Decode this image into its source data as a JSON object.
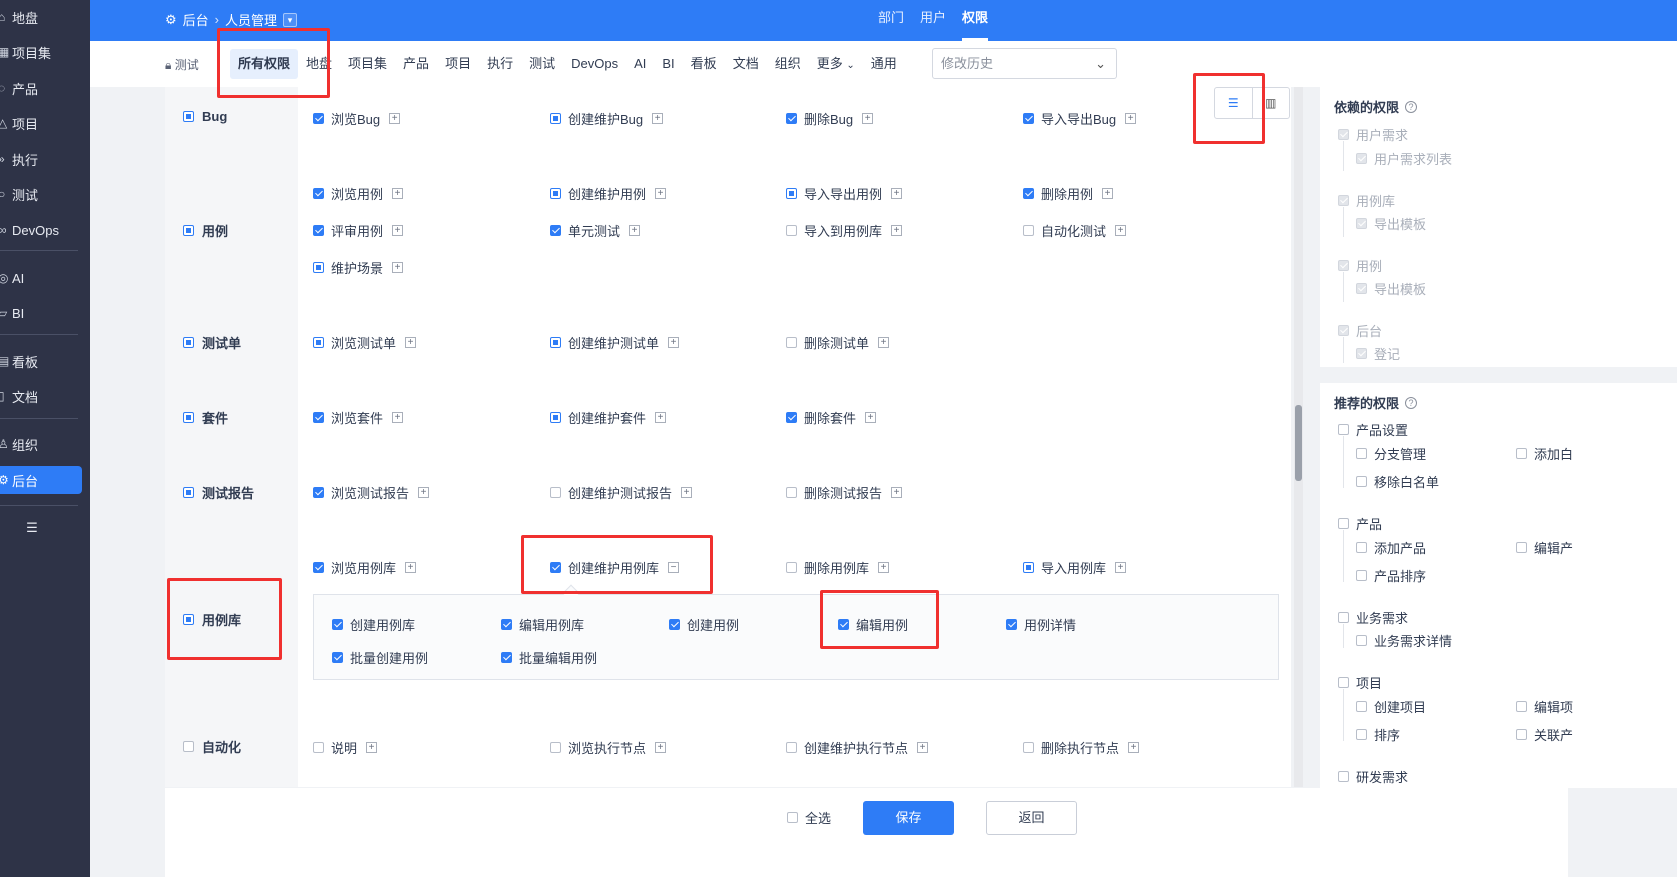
{
  "sidebar": {
    "items": [
      {
        "label": "地盘",
        "icon": "home-icon"
      },
      {
        "label": "项目集",
        "icon": "program-icon"
      },
      {
        "label": "产品",
        "icon": "product-icon"
      },
      {
        "label": "项目",
        "icon": "project-icon"
      },
      {
        "label": "执行",
        "icon": "execution-icon"
      },
      {
        "label": "测试",
        "icon": "test-icon"
      },
      {
        "label": "DevOps",
        "icon": "devops-icon"
      },
      {
        "label": "AI",
        "icon": "ai-icon"
      },
      {
        "label": "BI",
        "icon": "bi-icon"
      },
      {
        "label": "看板",
        "icon": "kanban-icon"
      },
      {
        "label": "文档",
        "icon": "doc-icon"
      },
      {
        "label": "组织",
        "icon": "org-icon"
      },
      {
        "label": "后台",
        "icon": "admin-gear-icon"
      }
    ],
    "active": "后台",
    "collapse_icon": "indent-icon"
  },
  "topbar": {
    "breadcrumb": [
      "后台",
      "人员管理"
    ],
    "nav": [
      "部门",
      "用户",
      "权限"
    ],
    "active_nav": "权限"
  },
  "subbar": {
    "group_label": "测试",
    "tabs": [
      "所有权限",
      "地盘",
      "项目集",
      "产品",
      "项目",
      "执行",
      "测试",
      "DevOps",
      "AI",
      "BI",
      "看板",
      "文档",
      "组织",
      "更多",
      "通用"
    ],
    "active_tab": "所有权限",
    "history_placeholder": "修改历史"
  },
  "categories": [
    {
      "label": "Bug",
      "state": "part"
    },
    {
      "label": "用例",
      "state": "part"
    },
    {
      "label": "测试单",
      "state": "part"
    },
    {
      "label": "套件",
      "state": "part"
    },
    {
      "label": "测试报告",
      "state": "part"
    },
    {
      "label": "用例库",
      "state": "part"
    },
    {
      "label": "自动化",
      "state": "off"
    }
  ],
  "permissions": {
    "bug": [
      {
        "label": "浏览Bug",
        "state": "on"
      },
      {
        "label": "创建维护Bug",
        "state": "part"
      },
      {
        "label": "删除Bug",
        "state": "on"
      },
      {
        "label": "导入导出Bug",
        "state": "on"
      }
    ],
    "case": [
      {
        "label": "浏览用例",
        "state": "on"
      },
      {
        "label": "创建维护用例",
        "state": "part"
      },
      {
        "label": "导入导出用例",
        "state": "part"
      },
      {
        "label": "删除用例",
        "state": "on"
      },
      {
        "label": "评审用例",
        "state": "on"
      },
      {
        "label": "单元测试",
        "state": "on"
      },
      {
        "label": "导入到用例库",
        "state": "off"
      },
      {
        "label": "自动化测试",
        "state": "off"
      },
      {
        "label": "维护场景",
        "state": "part"
      }
    ],
    "testtask": [
      {
        "label": "浏览测试单",
        "state": "part"
      },
      {
        "label": "创建维护测试单",
        "state": "part"
      },
      {
        "label": "删除测试单",
        "state": "off"
      }
    ],
    "suite": [
      {
        "label": "浏览套件",
        "state": "on"
      },
      {
        "label": "创建维护套件",
        "state": "part"
      },
      {
        "label": "删除套件",
        "state": "on"
      }
    ],
    "report": [
      {
        "label": "浏览测试报告",
        "state": "on"
      },
      {
        "label": "创建维护测试报告",
        "state": "off"
      },
      {
        "label": "删除测试报告",
        "state": "off"
      }
    ],
    "caselib": [
      {
        "label": "浏览用例库",
        "state": "on"
      },
      {
        "label": "创建维护用例库",
        "state": "on",
        "expanded": true
      },
      {
        "label": "删除用例库",
        "state": "off"
      },
      {
        "label": "导入用例库",
        "state": "part"
      }
    ],
    "caselib_sub": [
      {
        "label": "创建用例库",
        "state": "on"
      },
      {
        "label": "编辑用例库",
        "state": "on"
      },
      {
        "label": "创建用例",
        "state": "on"
      },
      {
        "label": "编辑用例",
        "state": "on"
      },
      {
        "label": "用例详情",
        "state": "on"
      },
      {
        "label": "批量创建用例",
        "state": "on"
      },
      {
        "label": "批量编辑用例",
        "state": "on"
      }
    ],
    "auto": [
      {
        "label": "说明",
        "state": "off"
      },
      {
        "label": "浏览执行节点",
        "state": "off"
      },
      {
        "label": "创建维护执行节点",
        "state": "off"
      },
      {
        "label": "删除执行节点",
        "state": "off"
      }
    ]
  },
  "depends": {
    "title": "依赖的权限",
    "groups": [
      {
        "label": "用户需求",
        "children": [
          "用户需求列表"
        ]
      },
      {
        "label": "用例库",
        "children": [
          "导出模板"
        ]
      },
      {
        "label": "用例",
        "children": [
          "导出模板"
        ]
      },
      {
        "label": "后台",
        "children": [
          "登记"
        ]
      }
    ]
  },
  "recommend": {
    "title": "推荐的权限",
    "groups": [
      {
        "label": "产品设置",
        "rows": [
          [
            "分支管理",
            "添加白"
          ],
          [
            "移除白名单"
          ]
        ]
      },
      {
        "label": "产品",
        "rows": [
          [
            "添加产品",
            "编辑产"
          ],
          [
            "产品排序"
          ]
        ]
      },
      {
        "label": "业务需求",
        "rows": [
          [
            "业务需求详情"
          ]
        ]
      },
      {
        "label": "项目",
        "rows": [
          [
            "创建项目",
            "编辑项"
          ],
          [
            "排序",
            "关联产"
          ]
        ]
      },
      {
        "label": "研发需求",
        "rows": []
      }
    ]
  },
  "footer": {
    "select_all": "全选",
    "save": "保存",
    "back": "返回"
  },
  "colors": {
    "primary": "#2e7cf6",
    "sidebar_bg": "#2e3347",
    "annotation_red": "#f0302f"
  }
}
